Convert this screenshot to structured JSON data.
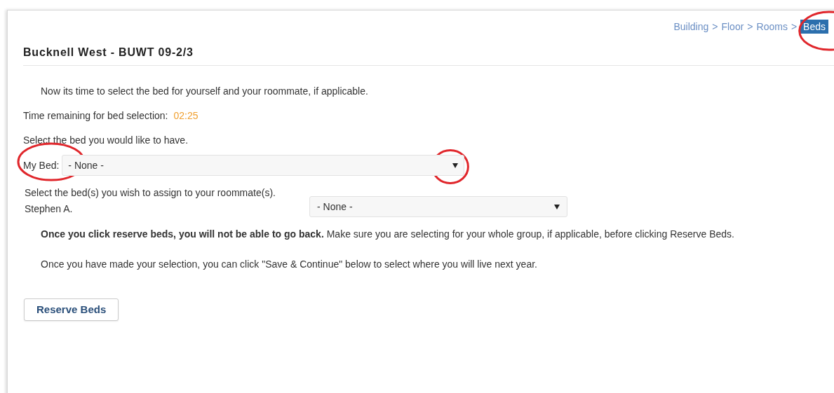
{
  "breadcrumb": [
    {
      "label": "Building",
      "selected": false,
      "circled": false
    },
    {
      "separator": ">",
      "label": "Floor",
      "selected": false,
      "circled": false
    },
    {
      "separator": ">",
      "label": "Rooms",
      "selected": false,
      "circled": false
    },
    {
      "separator": ">",
      "label": "Beds",
      "selected": true,
      "circled": true
    }
  ],
  "title": "Bucknell West - BUWT 09-2/3",
  "intro": "Now its time to select the bed for yourself and your roommate, if applicable.",
  "timer": {
    "label": "Time remaining for bed selection:",
    "value": "02:25"
  },
  "my_bed": {
    "prompt": "Select the bed you would like to have.",
    "label": "My Bed:",
    "value": "- None -",
    "label_circled": true,
    "arrow_circled": true
  },
  "roommates": {
    "prompt": "Select the bed(s) you wish to assign to your roommate(s).",
    "rows": [
      {
        "name": "Stephen A.",
        "value": "- None -"
      }
    ]
  },
  "warning": "**Once you click reserve beds, you will not be able to go back.** Make sure you are selecting for your whole group, if applicable, before clicking Reserve Beds.",
  "note": "Once you have made your selection, you can click \"Save & Continue\" below to select where you will live next year.",
  "button": "Reserve Beds"
}
